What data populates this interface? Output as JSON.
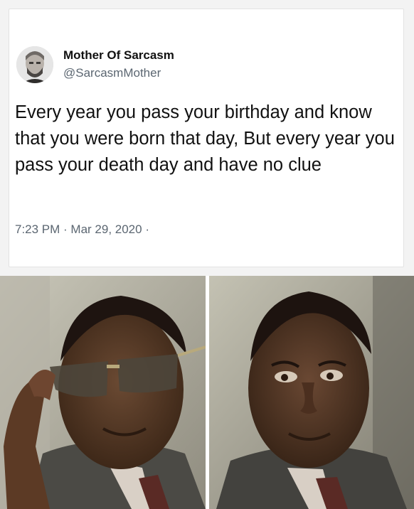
{
  "tweet": {
    "author_name": "Mother Of Sarcasm",
    "author_handle": "@SarcasmMother",
    "text": "Every year you pass your birthday and know that you were born that day, But every year you pass your death day and have no clue",
    "meta": "7:23 PM · Mar 29, 2020 ·"
  },
  "colors": {
    "card_background": "#ffffff",
    "text_primary": "#111111",
    "text_secondary": "#5b6671"
  },
  "images": {
    "avatar": "avatar-photo",
    "left_panel": "man-with-sunglasses-photo",
    "right_panel": "man-without-sunglasses-photo"
  }
}
